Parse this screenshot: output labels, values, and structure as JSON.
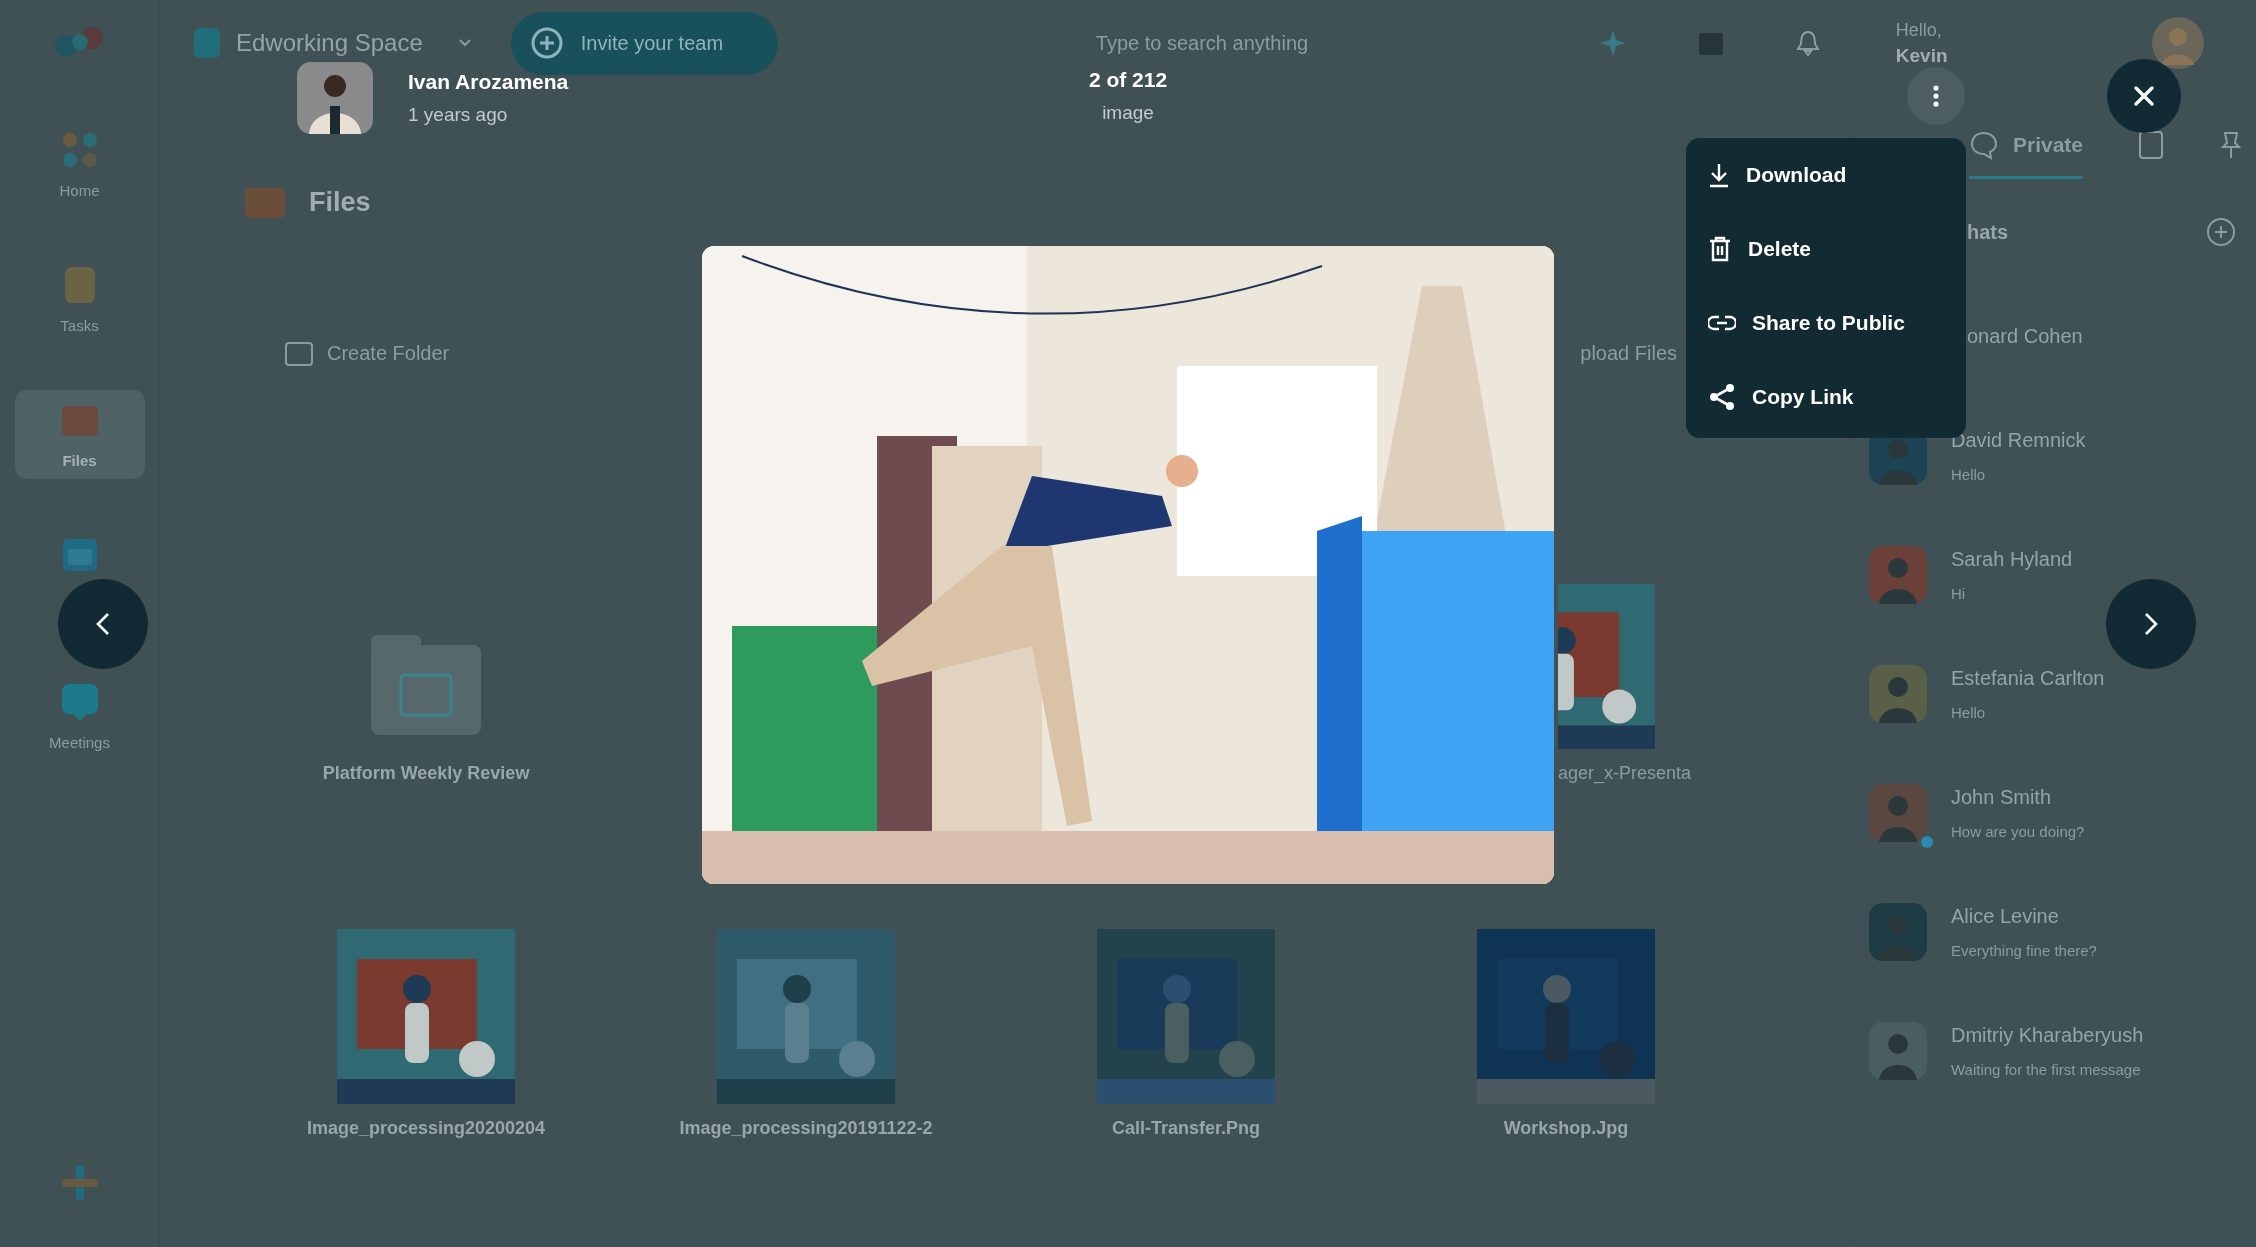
{
  "app": {
    "sidebar": {
      "items": [
        {
          "kind": "home",
          "label": "Home",
          "selected": false
        },
        {
          "kind": "tasks",
          "label": "Tasks",
          "selected": false
        },
        {
          "kind": "files",
          "label": "Files",
          "selected": true
        },
        {
          "kind": "calendar",
          "selected": false
        },
        {
          "kind": "meetings",
          "label": "Meetings",
          "selected": false
        }
      ]
    },
    "topbar": {
      "workspace": "Edworking Space",
      "invite_button": "Invite your team",
      "search": {
        "placeholder": "Type to search anything"
      },
      "greeting": "Hello,",
      "user_name": "Kevin"
    },
    "files": {
      "title": "Files",
      "create_folder": "Create Folder",
      "upload": "pload Files",
      "rows": [
        [
          {
            "kind": "folder",
            "name": "Platform Weekly Review"
          },
          "",
          "",
          {
            "kind": "partial_image",
            "name": "ager_x-Presenta"
          }
        ],
        [
          {
            "name": "Image_processing20200204"
          },
          {
            "name": "Image_processing20191122-2"
          },
          {
            "name": "Call-Transfer.Png"
          },
          {
            "name": "Workshop.Jpg"
          }
        ]
      ]
    },
    "chats": {
      "tabs": [
        {
          "kind": "private",
          "label": "Private",
          "selected": true
        },
        {
          "kind": "files",
          "selected": false
        },
        {
          "kind": "pin",
          "selected": false
        }
      ],
      "header": "hats",
      "items": [
        {
          "name": "onard Cohen"
        },
        {
          "name": "David Remnick",
          "message": "Hello",
          "online": false
        },
        {
          "name": "Sarah Hyland",
          "message": "Hi",
          "online": false
        },
        {
          "name": "Estefania Carlton",
          "message": "Hello",
          "online": false
        },
        {
          "name": "John Smith",
          "message": "How are you doing?",
          "online": true
        },
        {
          "name": "Alice Levine",
          "message": "Everything fine there?",
          "online": false
        },
        {
          "name": "Dmitriy Kharaberyush",
          "message": "Waiting for the first message",
          "online": false
        }
      ]
    }
  },
  "viewer": {
    "uploader": {
      "name": "Ivan Arozamena",
      "time": "1 years ago"
    },
    "counter": "2 of 212",
    "type": "image",
    "menu": [
      {
        "kind": "download",
        "label": "Download"
      },
      {
        "kind": "delete",
        "label": "Delete"
      },
      {
        "kind": "share_public",
        "label": "Share to Public"
      },
      {
        "kind": "copy_link",
        "label": "Copy Link"
      }
    ]
  }
}
